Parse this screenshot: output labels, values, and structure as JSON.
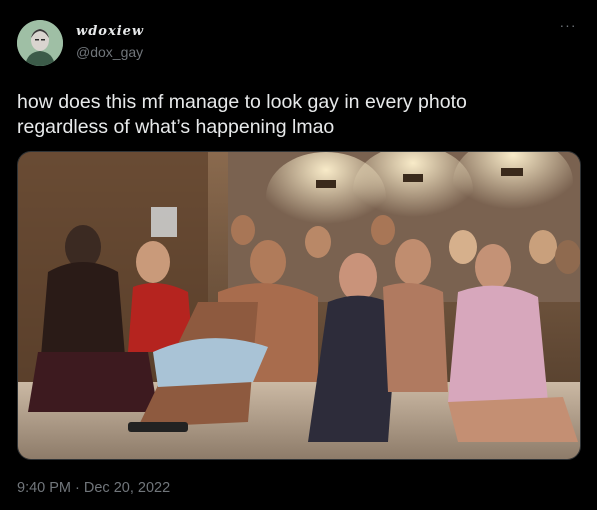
{
  "author": {
    "display_name": "wdoxiew",
    "handle": "@dox_gay",
    "avatar_icon": "avatar-portrait"
  },
  "menu": {
    "more_label": "···"
  },
  "tweet": {
    "text_line1": "how does this mf manage to look gay in every photo",
    "text_line2": "regardless of what’s happening lmao",
    "timestamp": "9:40 PM · Dec 20, 2022"
  },
  "colors": {
    "background": "#000000",
    "text_primary": "#e7e9ea",
    "text_secondary": "#71767b",
    "border": "#2f3336"
  }
}
